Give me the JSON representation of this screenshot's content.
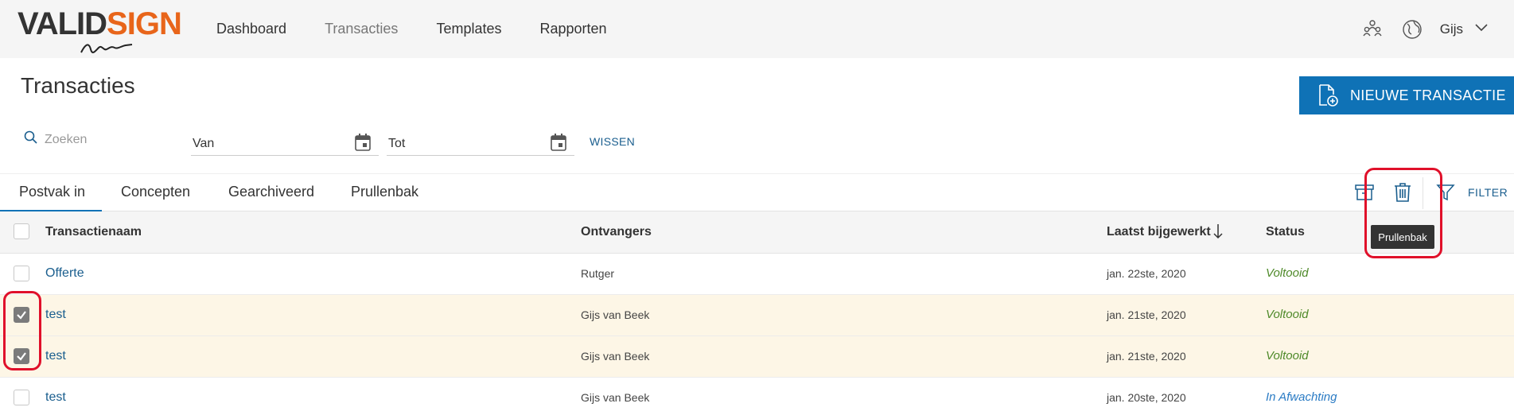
{
  "brand": {
    "part1": "VALID",
    "part2": "SIGN",
    "accent": "#e8651a"
  },
  "nav": {
    "items": [
      "Dashboard",
      "Transacties",
      "Templates",
      "Rapporten"
    ],
    "active": "Transacties"
  },
  "header": {
    "user": "Gijs",
    "icons": [
      "contacts-icon",
      "globe-icon",
      "chevron-down-icon"
    ]
  },
  "page": {
    "title": "Transacties",
    "new_button": "NIEUWE TRANSACTIE"
  },
  "filters": {
    "search_placeholder": "Zoeken",
    "from_label": "Van",
    "to_label": "Tot",
    "clear_label": "WISSEN"
  },
  "tabs": {
    "items": [
      "Postvak in",
      "Concepten",
      "Gearchiveerd",
      "Prullenbak"
    ],
    "active": "Postvak in"
  },
  "toolbar": {
    "filter_label": "FILTER",
    "tooltip": "Prullenbak"
  },
  "table": {
    "headers": {
      "name": "Transactienaam",
      "recipients": "Ontvangers",
      "updated": "Laatst bijgewerkt",
      "status": "Status"
    },
    "rows": [
      {
        "name": "Offerte",
        "recipients": "Rutger",
        "updated": "jan. 22ste, 2020",
        "status": "Voltooid",
        "checked": false
      },
      {
        "name": "test",
        "recipients": "Gijs van Beek",
        "updated": "jan. 21ste, 2020",
        "status": "Voltooid",
        "checked": true
      },
      {
        "name": "test",
        "recipients": "Gijs van Beek",
        "updated": "jan. 21ste, 2020",
        "status": "Voltooid",
        "checked": true
      },
      {
        "name": "test",
        "recipients": "Gijs van Beek",
        "updated": "jan. 20ste, 2020",
        "status": "In Afwachting",
        "checked": false
      }
    ]
  },
  "colors": {
    "primary": "#0f72b6",
    "link": "#1a5e8e",
    "status_done": "#4f8a2a",
    "status_pending": "#2a7bc4",
    "selected_row": "#fdf6e6",
    "annotation": "#e0102a"
  }
}
